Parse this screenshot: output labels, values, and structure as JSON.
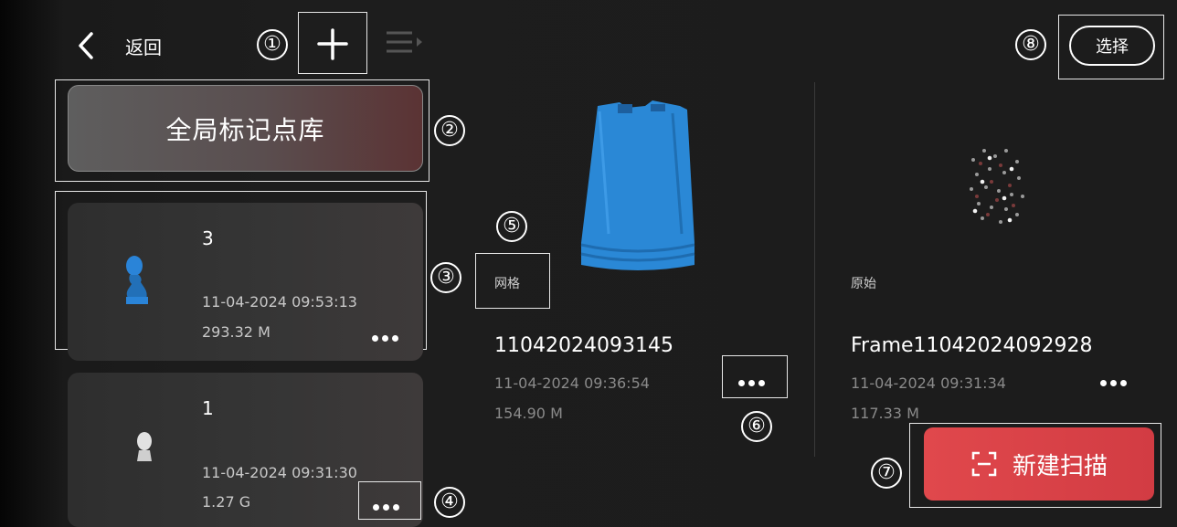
{
  "topbar": {
    "back_label": "返回",
    "select_label": "选择"
  },
  "annotations": {
    "n1": "①",
    "n2": "②",
    "n3": "③",
    "n4": "④",
    "n5": "⑤",
    "n6": "⑥",
    "n7": "⑦",
    "n8": "⑧"
  },
  "sidebar": {
    "global_marker_library": "全局标记点库",
    "items": [
      {
        "title": "3",
        "date": "11-04-2024 09:53:13",
        "size": "293.32 M",
        "thumb_color": "#2a84d8"
      },
      {
        "title": "1",
        "date": "11-04-2024 09:31:30",
        "size": "1.27 G",
        "thumb_color": "#cfcfcf"
      }
    ]
  },
  "projects": [
    {
      "tag": "网格",
      "title": "11042024093145",
      "date": "11-04-2024 09:36:54",
      "size": "154.90 M"
    },
    {
      "tag": "原始",
      "title": "Frame11042024092928",
      "date": "11-04-2024 09:31:34",
      "size": "117.33 M"
    }
  ],
  "new_scan": {
    "label": "新建扫描",
    "color": "#e0484c"
  },
  "icons": [
    "chevron-left-icon",
    "plus-icon",
    "list-sort-icon",
    "more-dots-icon",
    "scan-frame-icon"
  ]
}
